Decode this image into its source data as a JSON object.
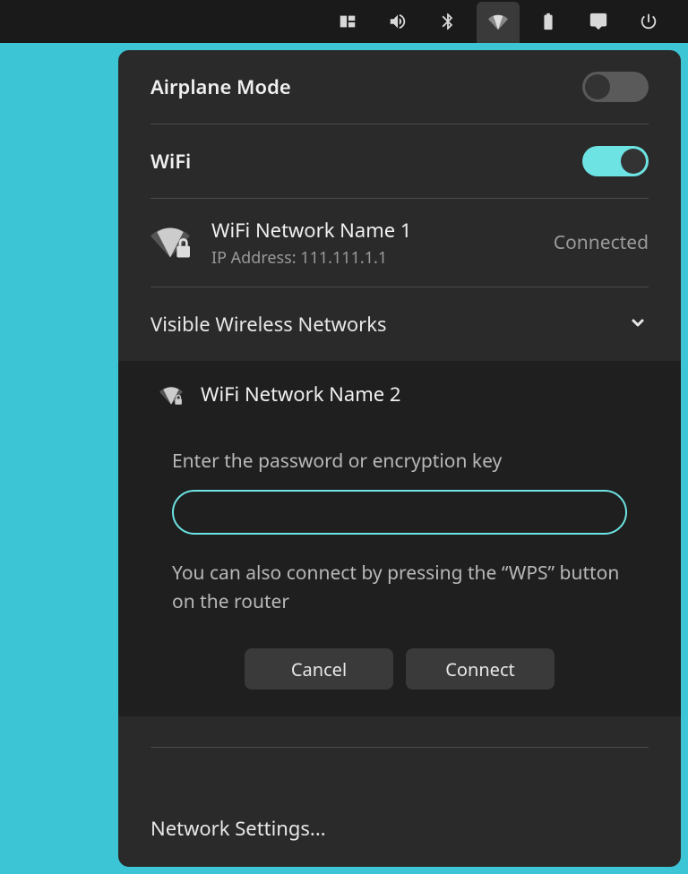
{
  "panel": {
    "airplane_label": "Airplane Mode",
    "airplane_on": false,
    "wifi_label": "WiFi",
    "wifi_on": true,
    "connected": {
      "name": "WiFi Network Name 1",
      "ip_label": "IP Address: 111.111.1.1",
      "status": "Connected"
    },
    "visible_section": "Visible Wireless Networks",
    "expanding": {
      "name": "WiFi Network Name 2",
      "prompt": "Enter the password or encryption key",
      "hint": "You can also connect by pressing the “WPS” button on the router",
      "cancel": "Cancel",
      "connect": "Connect"
    },
    "footer": "Network Settings..."
  }
}
